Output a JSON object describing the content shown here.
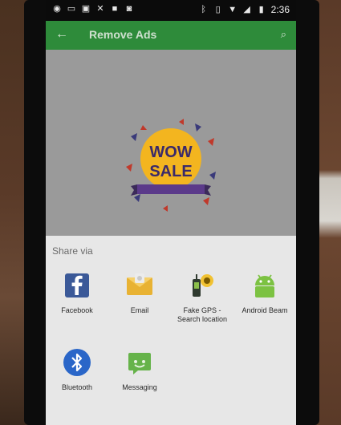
{
  "status_bar": {
    "time": "2:36"
  },
  "app_bar": {
    "title": "Remove Ads"
  },
  "promo": {
    "line1": "WOW",
    "line2": "SALE"
  },
  "share_sheet": {
    "title": "Share via",
    "items": [
      {
        "label": "Facebook",
        "icon": "facebook-icon"
      },
      {
        "label": "Email",
        "icon": "email-icon"
      },
      {
        "label": "Fake GPS -\nSearch location",
        "icon": "fake-gps-icon"
      },
      {
        "label": "Android Beam",
        "icon": "android-beam-icon"
      },
      {
        "label": "Bluetooth",
        "icon": "bluetooth-icon"
      },
      {
        "label": "Messaging",
        "icon": "messaging-icon"
      }
    ]
  },
  "colors": {
    "app_bar": "#2e8b3a",
    "sheet_bg": "#e7e7e7",
    "facebook": "#3b5998",
    "bluetooth": "#2a66c8",
    "android_green": "#7cc242",
    "sale_yellow": "#f3b51f"
  }
}
